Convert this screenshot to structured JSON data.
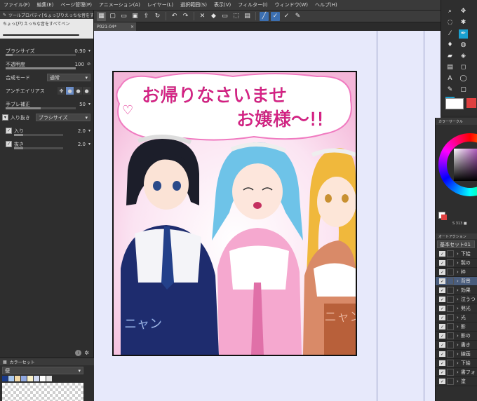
{
  "menu": [
    "ファイル(F)",
    "編集(E)",
    "ページ管理(P)",
    "アニメーション(A)",
    "レイヤー(L)",
    "選択範囲(S)",
    "表示(V)",
    "フィルター(I)",
    "ウィンドウ(W)",
    "ヘルプ(H)"
  ],
  "tool_property": {
    "tab_label": "ツールプロパティ[ちょっぴりえっちな音をすべて]",
    "brush_name": "ちょっぴりえっちな音をすべてペン",
    "brush_size_label": "ブラシサイズ",
    "brush_size_value": "0.90",
    "brush_size_fraction": 0.1,
    "opacity_label": "不透明度",
    "opacity_value": "100",
    "opacity_fraction": 1.0,
    "blend_label": "合成モード",
    "blend_value": "通常",
    "antialias_label": "アンチエイリアス",
    "stabilization_label": "手ブレ補正",
    "stabilization_value": "50",
    "stabilization_fraction": 0.5,
    "taper_label": "入り抜き",
    "taper_value": "ブラシサイズ",
    "taper_in_label": "入り",
    "taper_in_value": "2.0",
    "taper_out_label": "抜き",
    "taper_out_value": "2.0"
  },
  "left_bottom": {
    "tab_label": "カラーセット",
    "set_name": "便"
  },
  "canvas": {
    "tab_label": "P021-04*"
  },
  "artwork": {
    "line1": "お帰りなさいませ",
    "line2": "お嬢様〜!!",
    "sfx_left": "ニャン",
    "sfx_right": "ニャン"
  },
  "color_panel": {
    "title": "カラーサークル",
    "hsv_value": "S 313 ■"
  },
  "layer_panel": {
    "title": "オートアクション",
    "set_label": "基本セット01",
    "layers": [
      "下絵",
      "製の",
      "枠",
      "背景",
      "効果",
      "泣うつ",
      "発光",
      "光",
      "影",
      "影の",
      "書き",
      "線画",
      "下絵",
      "書フォ",
      "塗"
    ],
    "selected_index": 3
  },
  "colors": {
    "main_color": "#ffffff",
    "sub_color": "#e04040",
    "accent": "#3c6fb0"
  }
}
